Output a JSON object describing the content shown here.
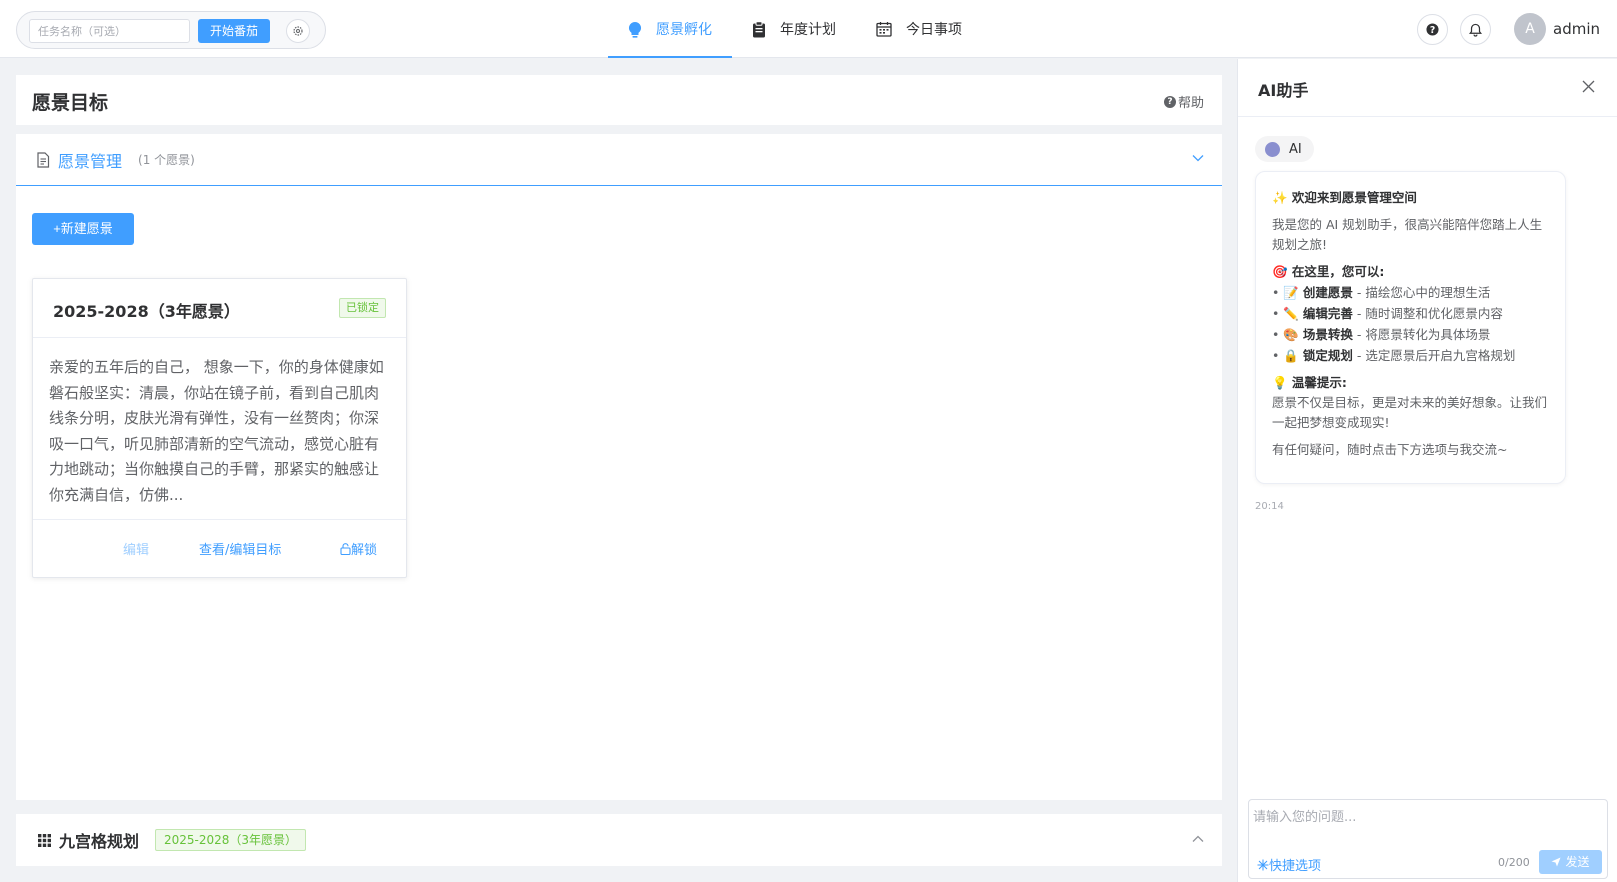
{
  "topbar": {
    "pomodoro": {
      "task_placeholder": "任务名称（可选）",
      "start_label": "开始番茄"
    },
    "nav": [
      {
        "label": "愿景孵化",
        "icon": "lightbulb-icon",
        "active": true
      },
      {
        "label": "年度计划",
        "icon": "clipboard-icon",
        "active": false
      },
      {
        "label": "今日事项",
        "icon": "calendar-icon",
        "active": false
      }
    ],
    "user": {
      "avatar_letter": "A",
      "name": "admin"
    }
  },
  "page": {
    "title": "愿景目标",
    "help_label": "帮助"
  },
  "vision_panel": {
    "title": "愿景管理",
    "count": "(1 个愿景)",
    "new_button": "+新建愿景",
    "cards": [
      {
        "title": "2025-2028（3年愿景）",
        "status": "已锁定",
        "body": "亲爱的五年后的自己， 想象一下，你的身体健康如磐石般坚实：清晨，你站在镜子前，看到自己肌肉线条分明，皮肤光滑有弹性，没有一丝赘肉；你深吸一口气，听见肺部清新的空气流动，感觉心脏有力地跳动；当你触摸自己的手臂，那紧实的触感让你充满自信，仿佛...",
        "actions": {
          "edit": "编辑",
          "view": "查看/编辑目标",
          "unlock": "解锁"
        }
      }
    ]
  },
  "grid_panel": {
    "title": "九宫格规划",
    "tag": "2025-2028（3年愿景）"
  },
  "ai": {
    "title": "AI助手",
    "tag": "AI",
    "message": {
      "welcome": "✨ 欢迎来到愿景管理空间",
      "intro": "我是您的 AI 规划助手，很高兴能陪伴您踏上人生规划之旅!",
      "can_heading": "🎯 在这里，您可以:",
      "features": [
        {
          "emoji": "📝",
          "name": "创建愿景",
          "desc": " - 描绘您心中的理想生活"
        },
        {
          "emoji": "✏️",
          "name": "编辑完善",
          "desc": " - 随时调整和优化愿景内容"
        },
        {
          "emoji": "🎨",
          "name": "场景转换",
          "desc": " - 将愿景转化为具体场景"
        },
        {
          "emoji": "🔒",
          "name": "锁定规划",
          "desc": " - 选定愿景后开启九宫格规划"
        }
      ],
      "tip_heading": "💡 温馨提示:",
      "tip": "愿景不仅是目标，更是对未来的美好想象。让我们一起把梦想变成现实!",
      "outro": "有任何疑问，随时点击下方选项与我交流~"
    },
    "time": "20:14",
    "input_placeholder": "请输入您的问题...",
    "quick_label": "快捷选项",
    "counter": "0/200",
    "send_label": "发送"
  },
  "colors": {
    "primary": "#409eff",
    "success": "#67c23a",
    "text": "#303133",
    "muted": "#909399"
  }
}
